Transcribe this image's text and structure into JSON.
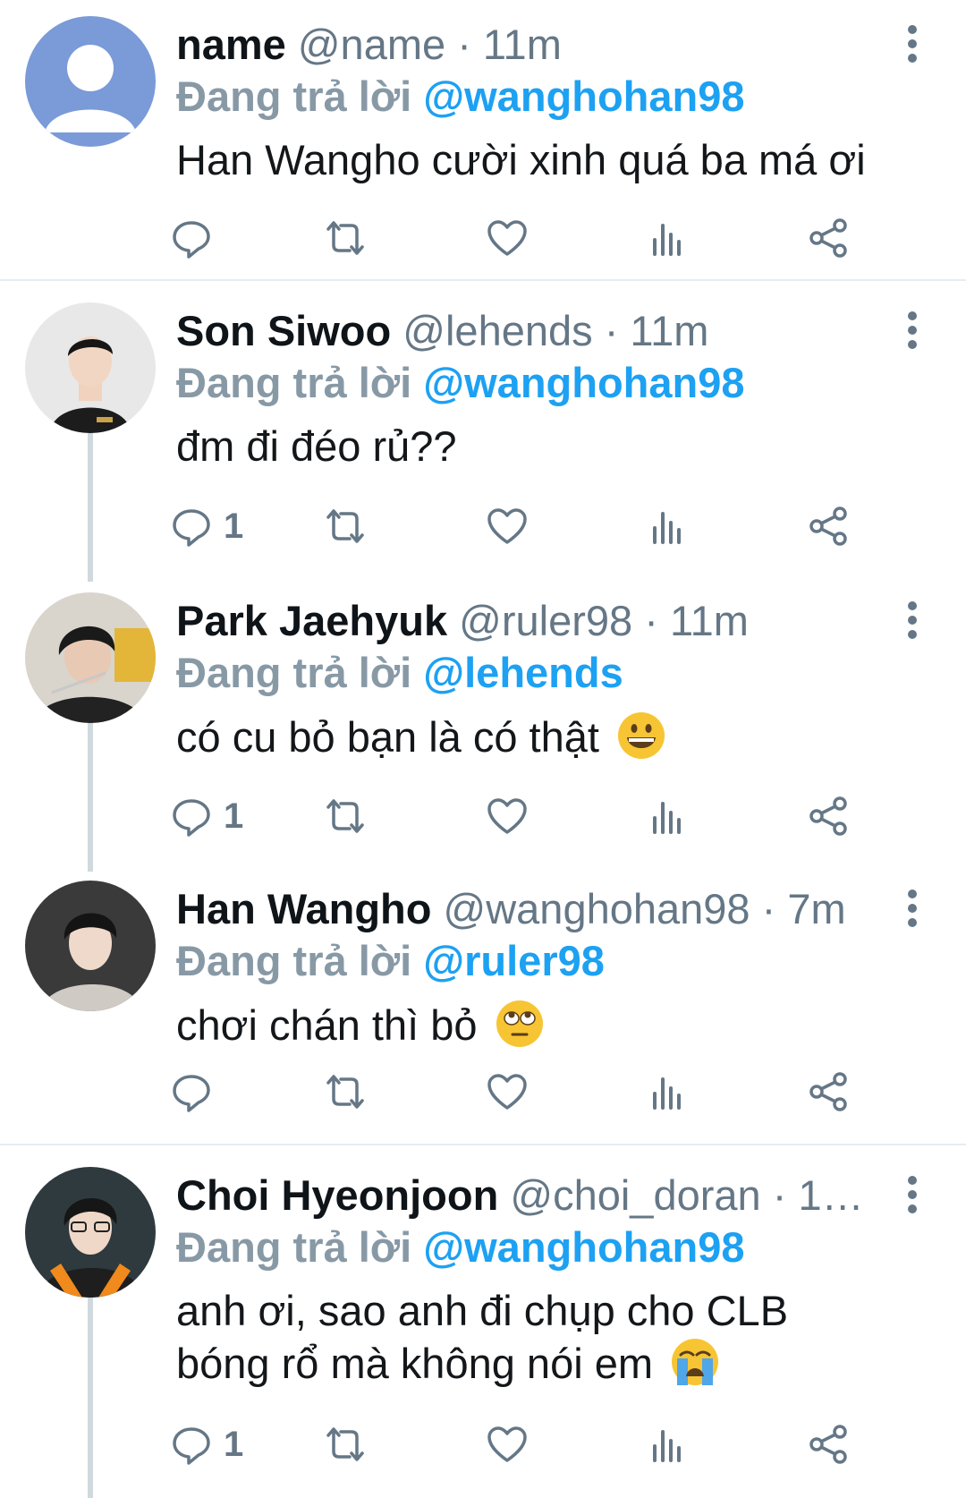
{
  "labels": {
    "replying_to": "Đang trả lời",
    "dot": "·"
  },
  "icons": {
    "reply": "reply-icon",
    "retweet": "retweet-icon",
    "like": "heart-icon",
    "analytics": "analytics-icon",
    "share": "share-icon",
    "more": "more-vertical-icon"
  },
  "colors": {
    "link": "#1da1f2",
    "muted": "#657786",
    "text": "#14171a"
  },
  "tweets": [
    {
      "name": "name",
      "handle": "@name",
      "time": "11m",
      "replying_to": "@wanghohan98",
      "text": "Han Wangho cười xinh quá ba má ơi",
      "emoji": "",
      "reply_count": ""
    },
    {
      "name": "Son Siwoo",
      "handle": "@lehends",
      "time": "11m",
      "replying_to": "@wanghohan98",
      "text": "đm đi đéo rủ??",
      "emoji": "",
      "reply_count": "1"
    },
    {
      "name": "Park Jaehyuk",
      "handle": "@ruler98",
      "time": "11m",
      "replying_to": "@lehends",
      "text": "có cu bỏ bạn là có thật",
      "emoji": "grinning-face",
      "reply_count": "1"
    },
    {
      "name": "Han Wangho",
      "handle": "@wanghohan98",
      "time": "7m",
      "replying_to": "@ruler98",
      "text": "chơi chán thì bỏ",
      "emoji": "eye-roll-face",
      "reply_count": ""
    },
    {
      "name": "Choi Hyeonjoon",
      "handle": "@choi_doran",
      "time": "1…",
      "replying_to": "@wanghohan98",
      "text": "anh ơi, sao anh đi chụp cho CLB bóng rổ mà không nói em",
      "emoji": "crying-face",
      "reply_count": "1"
    }
  ]
}
